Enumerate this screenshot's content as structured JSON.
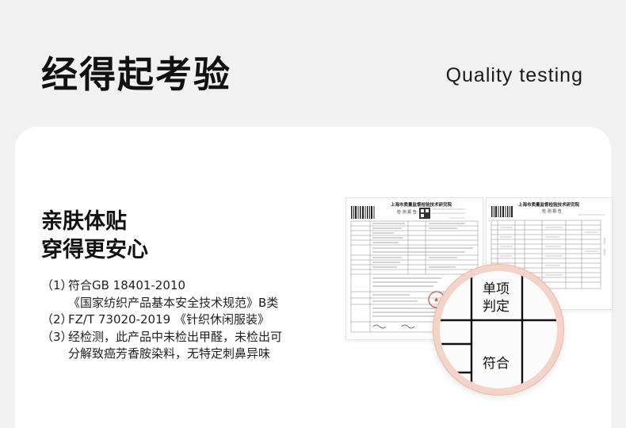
{
  "header": {
    "title_cn": "经得起考验",
    "title_en": "Quality testing"
  },
  "card": {
    "headline": [
      "亲肤体贴",
      "穿得更安心"
    ],
    "specs": [
      {
        "num": "（1）",
        "lines": [
          "符合GB 18401-2010",
          "《国家纺织产品基本安全技术规范》B类"
        ]
      },
      {
        "num": "（2）",
        "lines": [
          "FZ/T 73020-2019 《针织休闲服装》"
        ]
      },
      {
        "num": "（3）",
        "lines": [
          "经检测，此产品中未检出甲醛，未检出可",
          "分解致癌芳香胺染料，无特定刺鼻异味"
        ]
      }
    ]
  },
  "reports": {
    "report1": {
      "org": "上海市质量监督检验技术研究院",
      "title": "检 测 报 告"
    },
    "report2": {
      "org": "上海市质量监督检验技术研究院",
      "title": "检 测 报 告"
    }
  },
  "magnifier": {
    "label_line1": "单项",
    "label_line2": "判定",
    "result": "符合"
  },
  "colors": {
    "background": "#f1f1f1",
    "card": "#ffffff",
    "magnifier_ring": "#f4d4c8",
    "stamp": "#d9473a"
  }
}
